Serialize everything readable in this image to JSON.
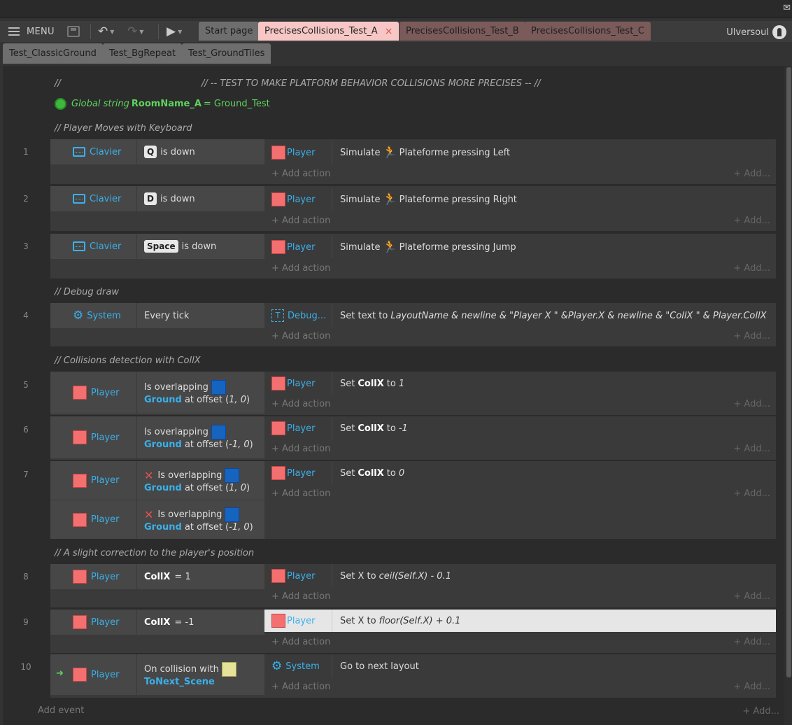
{
  "toolbar": {
    "menu_label": "MENU"
  },
  "tabs_row1": [
    {
      "label": "Start page"
    },
    {
      "label": "PrecisesCollisions_Test_A",
      "close": "×"
    },
    {
      "label": "PrecisesCollisions_Test_B"
    },
    {
      "label": "PrecisesCollisions_Test_C"
    }
  ],
  "tabs_row2": [
    {
      "label": "Test_ClassicGround"
    },
    {
      "label": "Test_BgRepeat"
    },
    {
      "label": "Test_GroundTiles"
    }
  ],
  "user": {
    "name": "Ulversoul"
  },
  "sheet": {
    "header_comment_slashes": "//",
    "header_comment": "// -- TEST TO MAKE PLATFORM BEHAVIOR COLLISIONS MORE PRECISES  -- //",
    "global": {
      "prefix": "Global string",
      "name": "RoomName_A",
      "eq": "=",
      "value": "Ground_Test"
    },
    "comments": [
      "//  Player Moves with Keyboard",
      "//  Debug draw",
      "//  Collisions detection with CollX",
      "//  A slight correction to the player's position"
    ],
    "add_action": "+ Add action",
    "add_right": "+ Add...",
    "add_event": "Add event"
  },
  "events": [
    {
      "num": "1",
      "obj": "Clavier",
      "key": "Q",
      "cond": "is down",
      "act_obj": "Player",
      "act_pre": "Simulate",
      "act_main": "Plateforme pressing Left"
    },
    {
      "num": "2",
      "obj": "Clavier",
      "key": "D",
      "cond": "is down",
      "act_obj": "Player",
      "act_pre": "Simulate",
      "act_main": "Plateforme pressing Right"
    },
    {
      "num": "3",
      "obj": "Clavier",
      "key": "Space",
      "cond": "is down",
      "act_obj": "Player",
      "act_pre": "Simulate",
      "act_main": "Plateforme pressing Jump"
    },
    {
      "num": "4",
      "obj": "System",
      "cond": "Every tick",
      "act_obj": "Debug...",
      "act_pre": "Set text to",
      "act_main": "LayoutName & newline & \"Player X \" &Player.X & newline & \"CollX \" & Player.CollX"
    },
    {
      "num": "5",
      "obj": "Player",
      "cond": "Is overlapping",
      "cond_obj": "Ground",
      "cond_tail": "at offset (",
      "cond_val": "1, 0",
      "cond_end": ")",
      "act_obj": "Player",
      "act_pre": "Set",
      "act_var": "CollX",
      "act_to": "to",
      "act_val": "1"
    },
    {
      "num": "6",
      "obj": "Player",
      "cond": "Is overlapping",
      "cond_obj": "Ground",
      "cond_tail": "at offset (",
      "cond_val": "-1, 0",
      "cond_end": ")",
      "act_obj": "Player",
      "act_pre": "Set",
      "act_var": "CollX",
      "act_to": "to",
      "act_val": "-1"
    },
    {
      "num": "7",
      "obj": "Player",
      "cond": "Is overlapping",
      "cond_obj": "Ground",
      "cond_tail": "at offset (",
      "cond_val": "1, 0",
      "cond_end": ")",
      "obj_b": "Player",
      "cond_b": "Is overlapping",
      "cond_obj_b": "Ground",
      "cond_val_b": "-1, 0",
      "act_obj": "Player",
      "act_pre": "Set",
      "act_var": "CollX",
      "act_to": "to",
      "act_val": "0"
    },
    {
      "num": "8",
      "obj": "Player",
      "cond_var": "CollX",
      "cond_expr": "= 1",
      "act_obj": "Player",
      "act_pre": "Set X to",
      "act_main": "ceil(Self.X) - 0.1"
    },
    {
      "num": "9",
      "obj": "Player",
      "cond_var": "CollX",
      "cond_expr": "= -1",
      "act_obj": "Player",
      "act_pre": "Set X to",
      "act_main": "floor(Self.X) + 0.1"
    },
    {
      "num": "10",
      "obj": "Player",
      "cond": "On collision with",
      "cond_obj": "ToNext_Scene",
      "act_obj": "System",
      "act_pre": "Go to next layout"
    }
  ],
  "colors": {
    "object_blue": "#3ab0ea",
    "sprite_red": "#f47070",
    "global_green": "#5fd35f",
    "highlight_row": "#e6e6e6"
  },
  "icons": [
    "menu-icon",
    "save-icon",
    "undo-icon",
    "redo-icon",
    "play-icon",
    "keyboard-icon",
    "gear-icon",
    "runner-icon",
    "globe-icon",
    "text-object-icon",
    "invert-x-icon",
    "trigger-arrow-icon"
  ]
}
